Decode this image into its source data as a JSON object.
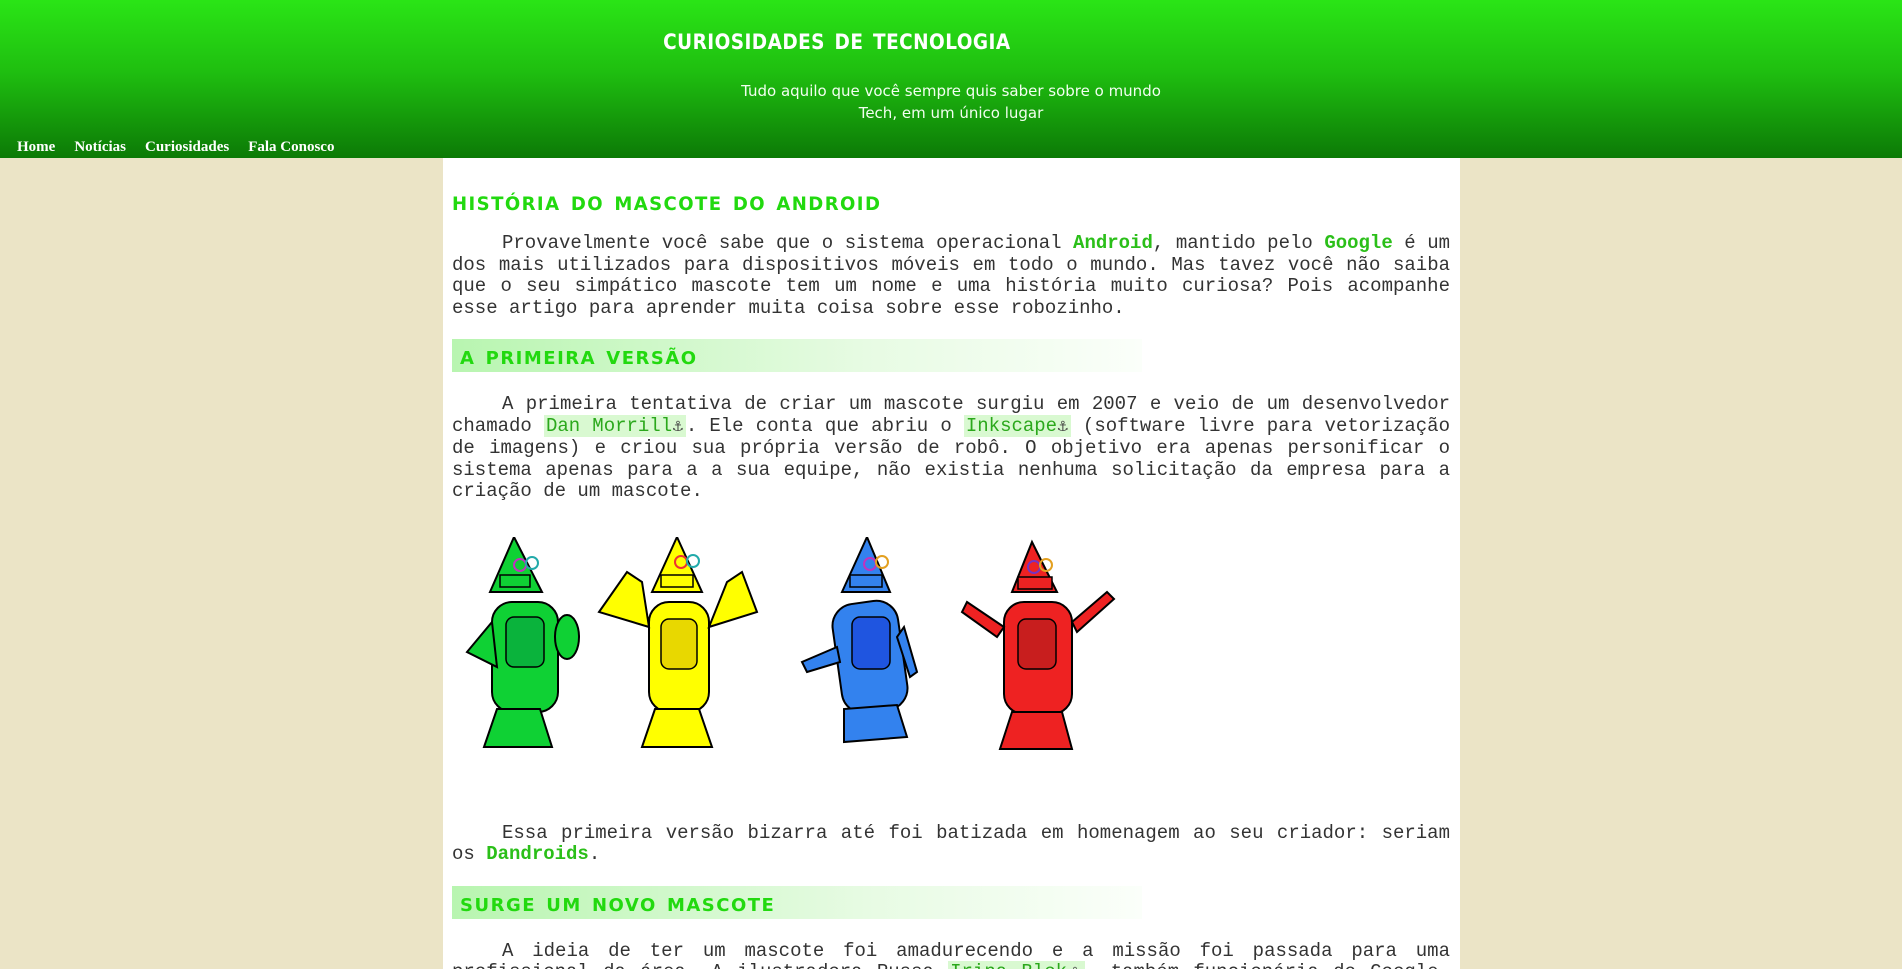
{
  "header": {
    "title": "CURIOSIDADES DE TECNOLOGIA",
    "subtitle_line1": "Tudo aquilo que você sempre quis saber sobre o mundo",
    "subtitle_line2": "Tech, em um único lugar"
  },
  "nav": {
    "items": [
      "Home",
      "Notícias",
      "Curiosidades",
      "Fala Conosco"
    ]
  },
  "article": {
    "title": "História do Mascote do Android",
    "intro": {
      "t1": "Provavelmente você sabe que o sistema operacional ",
      "b1": "Android",
      "t2": ", mantido pelo ",
      "b2": "Google",
      "t3": " é um dos mais utilizados para dispositivos móveis em todo o mundo. Mas tavez você não saiba que o seu simpático mascote tem um nome e uma história muito curiosa? Pois acompanhe esse artigo para aprender muita coisa sobre esse robozinho."
    },
    "section1": {
      "heading": "A Primeira Versão",
      "p1": {
        "t1": "A primeira tentativa de criar um mascote surgiu em 2007 e veio de um desenvolvedor chamado ",
        "link1": "Dan Morrill",
        "t2": ". Ele conta que abriu o ",
        "link2": "Inkscape",
        "t3": " (software livre para vetorização de imagens) e criou sua própria versão de robô. O objetivo era apenas personificar o sistema apenas para a a sua equipe, não existia nenhuma solicitação da empresa para a criação de um mascote."
      },
      "p2": {
        "t1": "Essa primeira versão bizarra até foi batizada em homenagem ao seu criador: seriam os ",
        "b1": "Dandroids",
        "t2": "."
      }
    },
    "section2": {
      "heading": "Surge um novo mascote",
      "p1": {
        "t1": "A ideia de ter um mascote foi amadurecendo e a missão foi passada para uma profissional da área. A ilustradora Russa ",
        "link1": "Irina Blok",
        "t2": ", também funcionária do Google, ficou encarregada de criar o novo robô, o verde que conhecemos hoje."
      }
    }
  },
  "icons": {
    "external_link": "anchor-icon",
    "anchor_glyph": "⚓"
  },
  "colors": {
    "header_top": "#2ae516",
    "header_bottom": "#0c7a06",
    "accent": "#22d90f",
    "page_bg": "#ebe4c6",
    "robots": [
      "#0fd134",
      "#ffff00",
      "#3382ee",
      "#ee2222"
    ]
  }
}
